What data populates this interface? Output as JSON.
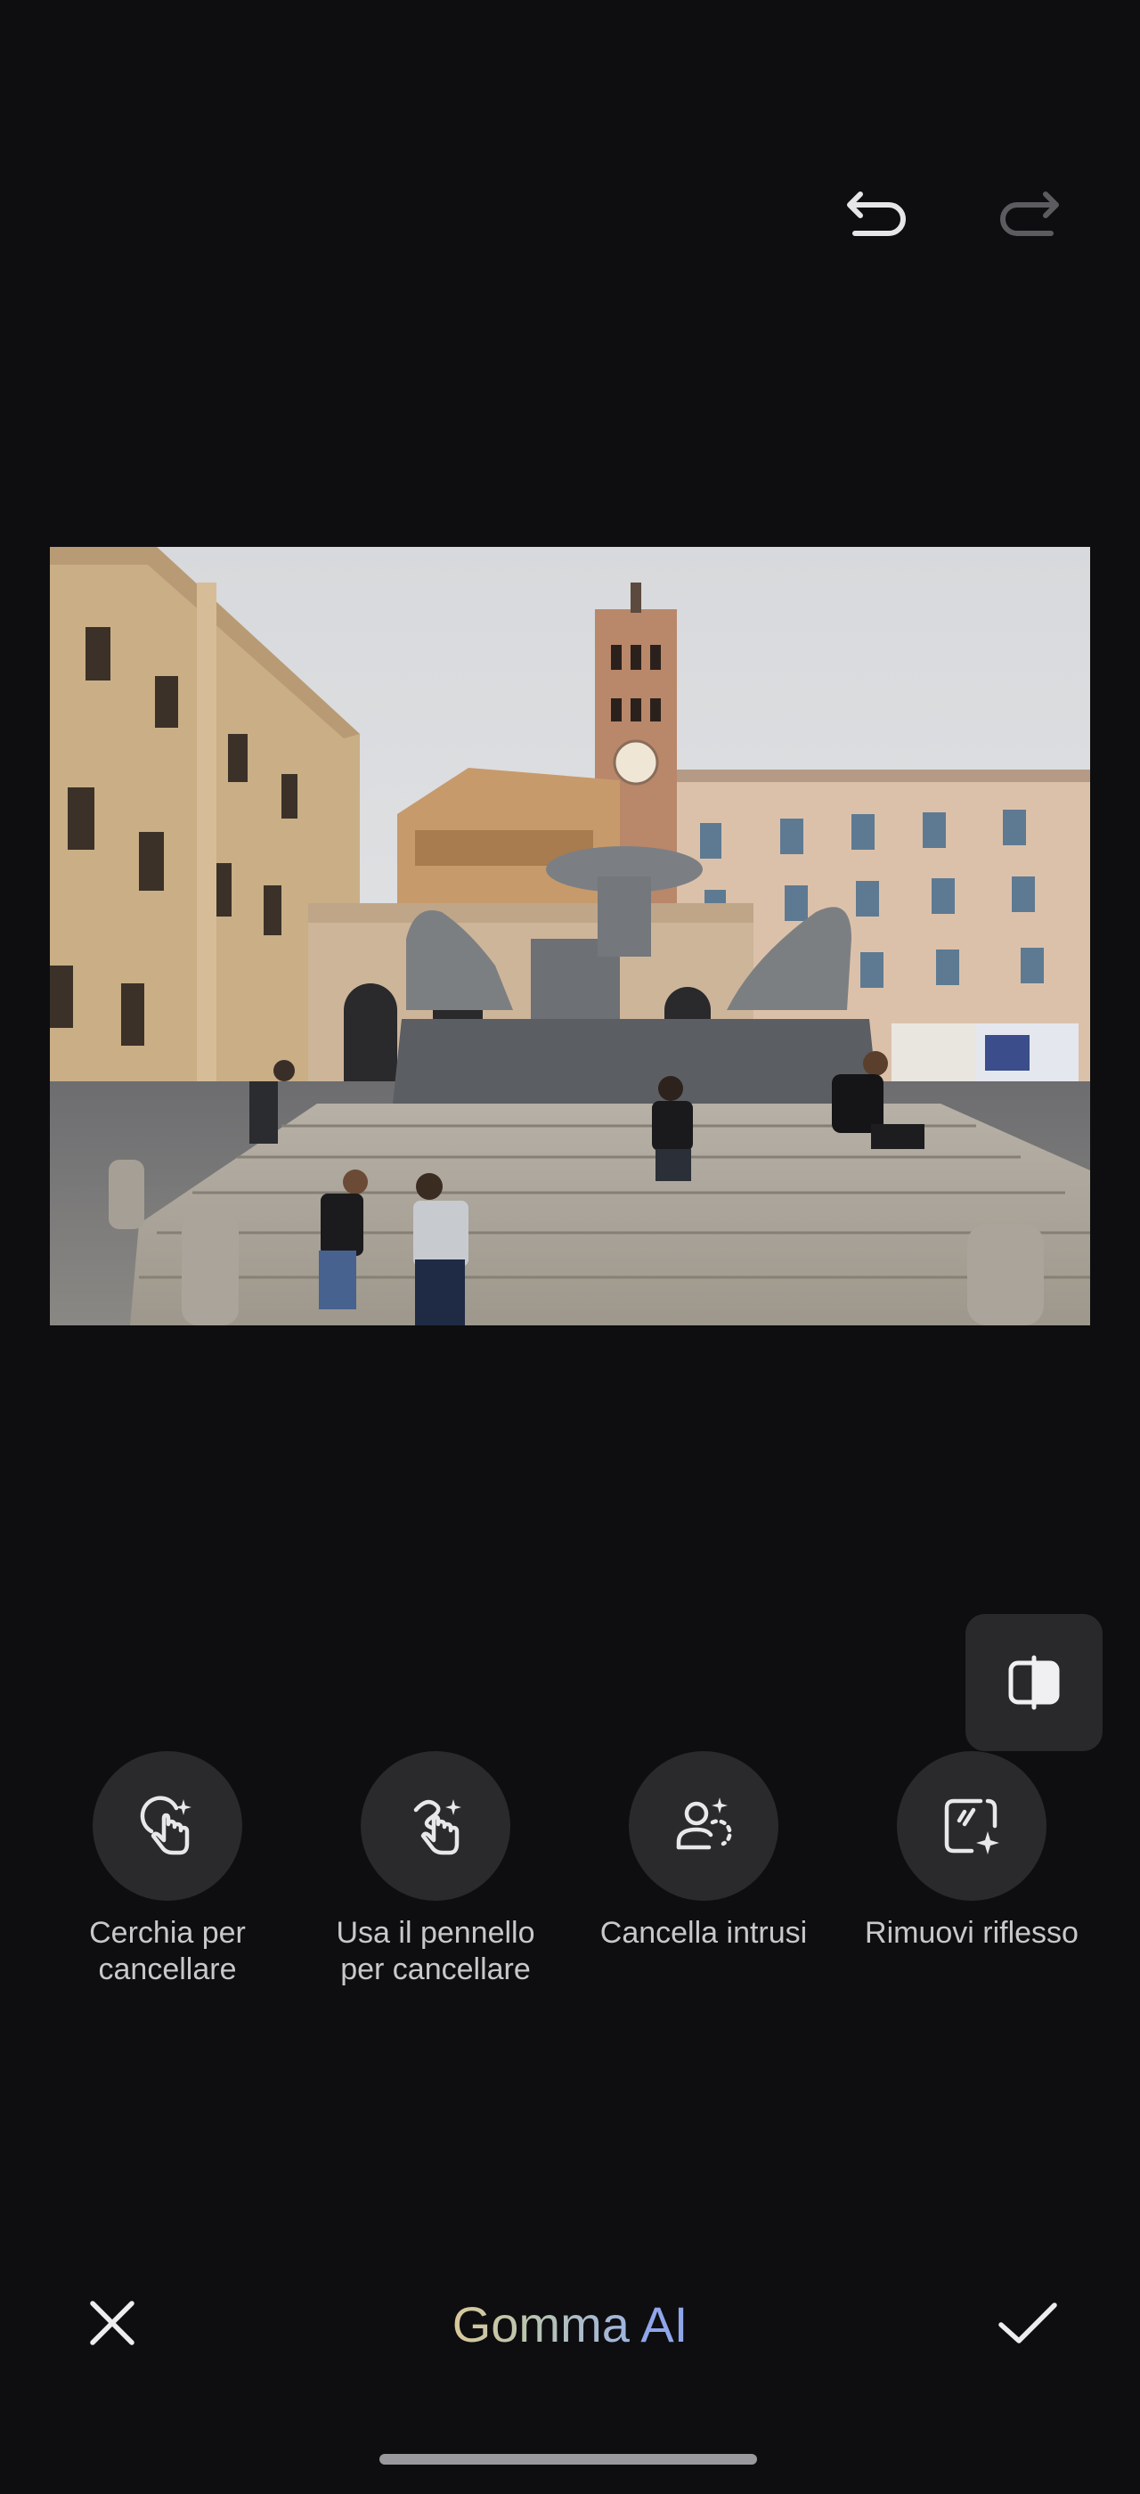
{
  "toolbar": {
    "undo_icon": "undo-icon",
    "redo_icon": "redo-icon",
    "redo_enabled": false
  },
  "photo": {
    "description_icon": "photo-image"
  },
  "compare": {
    "icon": "compare-icon"
  },
  "tools": [
    {
      "label_line1": "Cerchia per",
      "label_line2": "cancellare",
      "icon": "circle-erase-icon"
    },
    {
      "label_line1": "Usa il pennello",
      "label_line2": "per cancellare",
      "icon": "brush-erase-icon"
    },
    {
      "label_line1": "Cancella intrusi",
      "label_line2": "",
      "icon": "remove-people-icon"
    },
    {
      "label_line1": "Rimuovi riflesso",
      "label_line2": "",
      "icon": "remove-reflection-icon"
    }
  ],
  "bottom_bar": {
    "title_part1": "Gomma",
    "title_part2": "AI",
    "cancel_icon": "close-icon",
    "confirm_icon": "check-icon"
  },
  "colors": {
    "background": "#0e0e10",
    "tool_circle": "#2a2a2d",
    "accent_blue": "#8fa6ea"
  }
}
